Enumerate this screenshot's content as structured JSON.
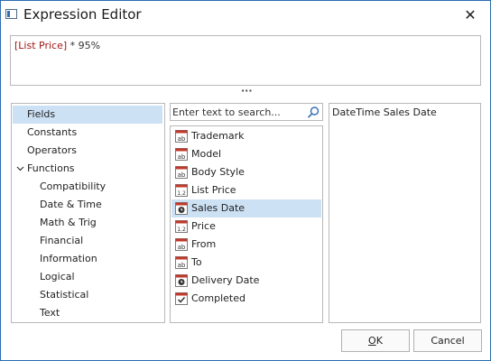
{
  "window": {
    "title": "Expression Editor",
    "close_glyph": "✕"
  },
  "expression": {
    "field": "[List Price]",
    "rest": " * 95%"
  },
  "splitter": {
    "glyph": "···"
  },
  "categories": [
    {
      "label": "Fields",
      "selected": true,
      "indent": 0
    },
    {
      "label": "Constants",
      "indent": 0
    },
    {
      "label": "Operators",
      "indent": 0
    },
    {
      "label": "Functions",
      "indent": 0,
      "expanded": true
    },
    {
      "label": "Compatibility",
      "indent": 1
    },
    {
      "label": "Date & Time",
      "indent": 1
    },
    {
      "label": "Math & Trig",
      "indent": 1
    },
    {
      "label": "Financial",
      "indent": 1
    },
    {
      "label": "Information",
      "indent": 1
    },
    {
      "label": "Logical",
      "indent": 1
    },
    {
      "label": "Statistical",
      "indent": 1
    },
    {
      "label": "Text",
      "indent": 1
    }
  ],
  "search": {
    "placeholder": "Enter text to search..."
  },
  "fields": [
    {
      "label": "Trademark",
      "icon": "string-field-icon"
    },
    {
      "label": "Model",
      "icon": "string-field-icon"
    },
    {
      "label": "Body Style",
      "icon": "string-field-icon"
    },
    {
      "label": "List Price",
      "icon": "numeric-field-icon"
    },
    {
      "label": "Sales Date",
      "icon": "datetime-field-icon",
      "selected": true
    },
    {
      "label": "Price",
      "icon": "numeric-field-icon"
    },
    {
      "label": "From",
      "icon": "string-field-icon"
    },
    {
      "label": "To",
      "icon": "string-field-icon"
    },
    {
      "label": "Delivery Date",
      "icon": "datetime-field-icon"
    },
    {
      "label": "Completed",
      "icon": "boolean-field-icon"
    }
  ],
  "description": "DateTime Sales Date",
  "buttons": {
    "ok_mnemonic": "O",
    "ok_rest": "K",
    "cancel": "Cancel"
  },
  "colors": {
    "accent_red": "#c0392b",
    "selection": "#cde1f5",
    "field_token": "#a31515"
  }
}
